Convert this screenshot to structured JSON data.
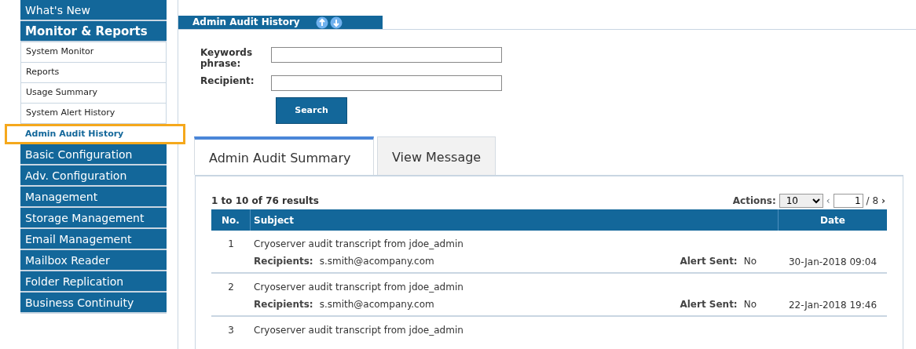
{
  "sidebar": {
    "items": [
      {
        "label": "What's New"
      },
      {
        "label": "Monitor & Reports",
        "children": [
          {
            "label": "System Monitor",
            "selected": false
          },
          {
            "label": "Reports",
            "selected": false
          },
          {
            "label": "Usage Summary",
            "selected": false
          },
          {
            "label": "System Alert History",
            "selected": false
          },
          {
            "label": "Admin Audit History",
            "selected": true
          }
        ]
      },
      {
        "label": "Basic Configuration"
      },
      {
        "label": "Adv. Configuration"
      },
      {
        "label": "Management"
      },
      {
        "label": "Storage Management"
      },
      {
        "label": "Email Management"
      },
      {
        "label": "Mailbox Reader"
      },
      {
        "label": "Folder Replication"
      },
      {
        "label": "Business Continuity"
      }
    ]
  },
  "page_title": "Admin Audit History",
  "form": {
    "fields": [
      {
        "label": "Keywords phrase:"
      },
      {
        "label": "Recipient:"
      }
    ],
    "button": "Search"
  },
  "tabs": [
    {
      "label": "Admin Audit Summary",
      "selected": true
    },
    {
      "label": "View Message",
      "selected": false
    }
  ],
  "results": {
    "summary": "1 to 10 of 76 results",
    "actions_label": "Actions:",
    "page_size": "10",
    "prev": "‹",
    "page": "1",
    "next": "›",
    "page_total": "/ 8",
    "columns": [
      "No.",
      "Subject",
      "Date"
    ],
    "rows": [
      {
        "no": "1",
        "subject": "Cryoserver audit transcript from jdoe_admin",
        "recipients_label": "Recipients:",
        "recipients": "s.smith@acompany.com",
        "alert_label": "Alert Sent:",
        "alert": "No",
        "date": "30-Jan-2018 09:04"
      },
      {
        "no": "2",
        "subject": "Cryoserver audit transcript from jdoe_admin",
        "recipients_label": "Recipients:",
        "recipients": "s.smith@acompany.com",
        "alert_label": "Alert Sent:",
        "alert": "No",
        "date": "22-Jan-2018 19:46"
      },
      {
        "no": "3",
        "subject": "Cryoserver audit transcript from jdoe_admin"
      }
    ]
  }
}
